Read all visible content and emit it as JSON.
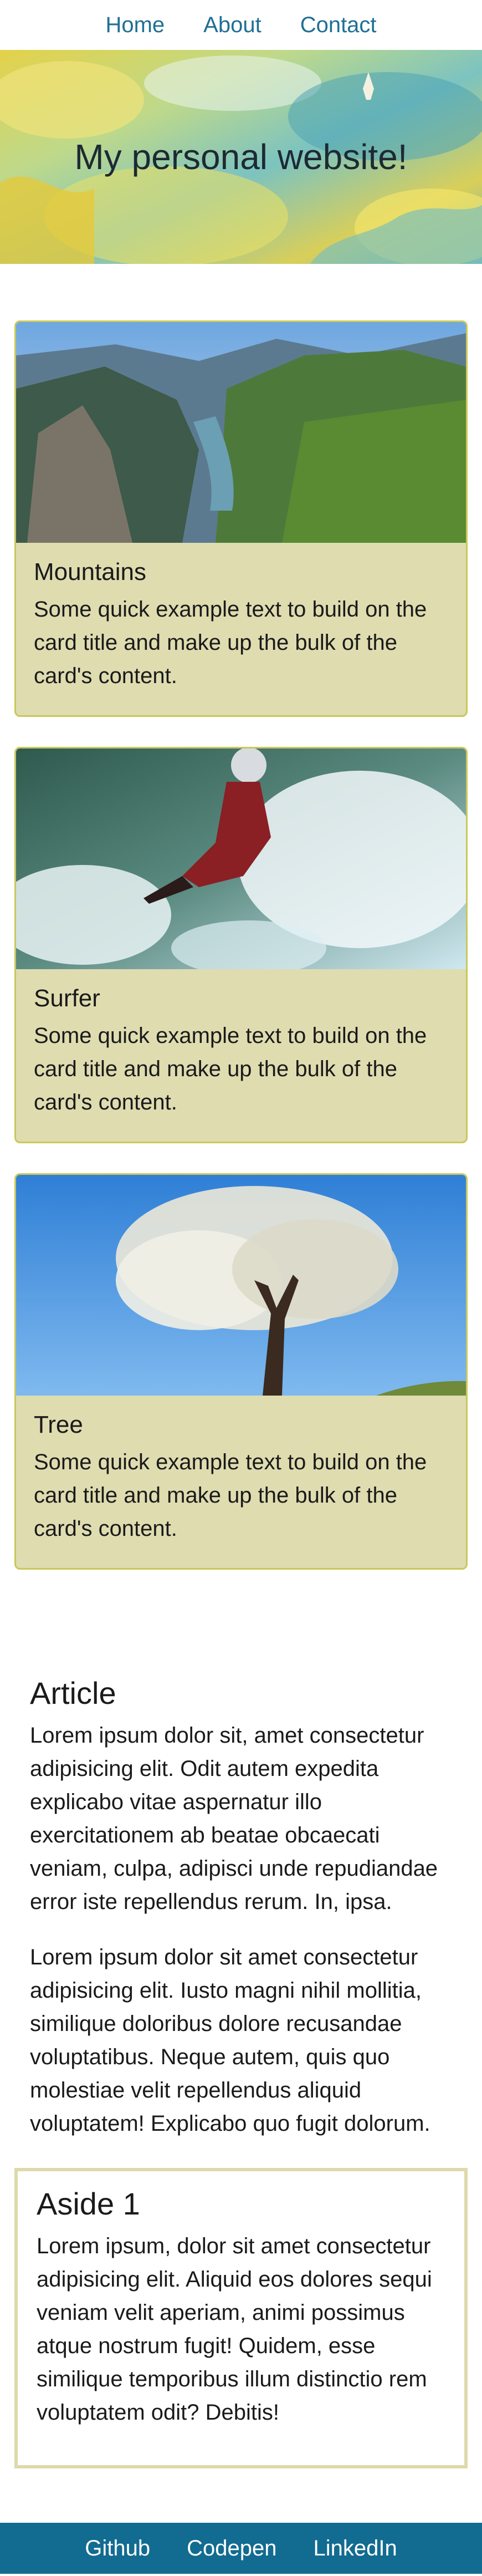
{
  "nav": {
    "links": [
      "Home",
      "About",
      "Contact"
    ]
  },
  "hero": {
    "title": "My personal website!"
  },
  "cards": [
    {
      "title": "Mountains",
      "text": "Some quick example text to build on the card title and make up the bulk of the card's content."
    },
    {
      "title": "Surfer",
      "text": "Some quick example text to build on the card title and make up the bulk of the card's content."
    },
    {
      "title": "Tree",
      "text": "Some quick example text to build on the card title and make up the bulk of the card's content."
    }
  ],
  "article": {
    "heading": "Article",
    "paragraphs": [
      "Lorem ipsum dolor sit, amet consectetur adipisicing elit. Odit autem expedita explicabo vitae aspernatur illo exercitationem ab beatae obcaecati veniam, culpa, adipisci unde repudiandae error iste repellendus rerum. In, ipsa.",
      "Lorem ipsum dolor sit amet consectetur adipisicing elit. Iusto magni nihil mollitia, similique doloribus dolore recusandae voluptatibus. Neque autem, quis quo molestiae velit repellendus aliquid voluptatem! Explicabo quo fugit dolorum."
    ]
  },
  "aside": {
    "heading": "Aside 1",
    "text": "Lorem ipsum, dolor sit amet consectetur adipisicing elit. Aliquid eos dolores sequi veniam velit aperiam, animi possimus atque nostrum fugit! Quidem, esse similique temporibus illum distinctio rem voluptatem odit? Debitis!"
  },
  "footer": {
    "links": [
      "Github",
      "Codepen",
      "LinkedIn"
    ]
  },
  "colors": {
    "nav_link": "#1f6f95",
    "card_bg": "#dfdcb0",
    "card_border": "#c9c85a",
    "footer_bg": "#126b90",
    "aside_border": "#ded9aa"
  }
}
